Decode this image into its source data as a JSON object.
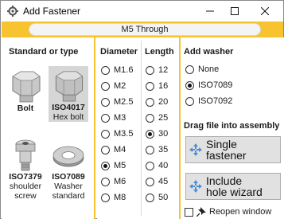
{
  "window": {
    "title": "Add Fastener",
    "minimize": "—",
    "maximize": "☐",
    "close": "✕"
  },
  "banner": {
    "selection_text": "M5 Through",
    "color": "#f7c32e"
  },
  "standard": {
    "heading": "Standard or type",
    "cards": [
      {
        "bold": "Bolt",
        "sub": "",
        "selected": false,
        "icon": "hex-bolt-icon"
      },
      {
        "bold": "ISO4017",
        "sub": "Hex bolt",
        "selected": true,
        "icon": "hex-bolt-icon"
      },
      {
        "bold": "ISO7379",
        "sub": "shoulder screw",
        "selected": false,
        "icon": "shoulder-screw-icon"
      },
      {
        "bold": "ISO7089",
        "sub": "Washer standard",
        "selected": false,
        "icon": "washer-icon"
      }
    ]
  },
  "diameter": {
    "heading": "Diameter",
    "options": [
      "M1.6",
      "M2",
      "M2.5",
      "M3",
      "M3.5",
      "M4",
      "M5",
      "M6",
      "M8"
    ],
    "selected": "M5"
  },
  "length": {
    "heading": "Length",
    "options": [
      "12",
      "16",
      "20",
      "25",
      "30",
      "35",
      "40",
      "45",
      "50"
    ],
    "selected": "30"
  },
  "washer": {
    "heading": "Add washer",
    "options": [
      "None",
      "ISO7089",
      "ISO7092"
    ],
    "selected": "ISO7089"
  },
  "drag": {
    "heading": "Drag file into assembly",
    "single_label": "Single fastener",
    "wizard_line1": "Include",
    "wizard_line2": "hole wizard",
    "reopen_label": "Reopen window",
    "reopen_checked": false
  }
}
